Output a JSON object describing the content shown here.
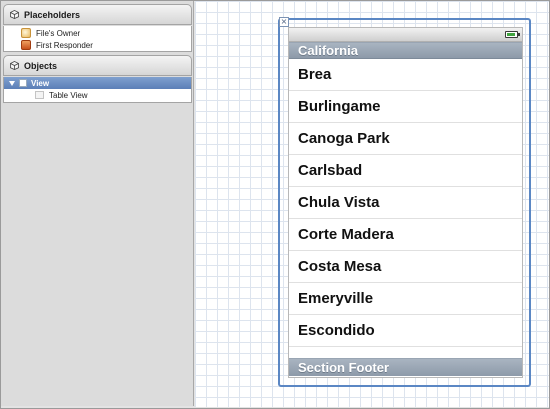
{
  "placeholders": {
    "header": "Placeholders",
    "items": [
      {
        "label": "File's Owner",
        "icon": "files-owner-icon"
      },
      {
        "label": "First Responder",
        "icon": "first-responder-icon"
      }
    ]
  },
  "objects": {
    "header": "Objects",
    "items": [
      {
        "label": "View",
        "selected": true
      },
      {
        "label": "Table View",
        "selected": false
      }
    ]
  },
  "table": {
    "section_header": "California",
    "rows": [
      "Brea",
      "Burlingame",
      "Canoga Park",
      "Carlsbad",
      "Chula Vista",
      "Corte Madera",
      "Costa Mesa",
      "Emeryville",
      "Escondido"
    ],
    "section_footer": "Section Footer"
  },
  "colors": {
    "selection_blue": "#5b87c4",
    "section_header_bg": "#9aa6b4",
    "battery_green": "#3fa33f"
  }
}
